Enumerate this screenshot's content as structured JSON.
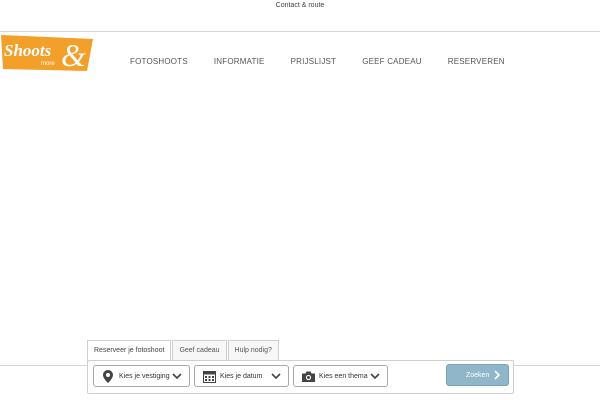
{
  "header": {
    "contact_label": "Contact & route"
  },
  "logo": {
    "word_main": "Shoots",
    "word_sub": "more",
    "ampersand": "&",
    "bg_color": "#f3a02b"
  },
  "nav": {
    "items": [
      {
        "label": "FOTOSHOOTS"
      },
      {
        "label": "INFORMATIE"
      },
      {
        "label": "PRIJSLIJST"
      },
      {
        "label": "GEEF CADEAU"
      },
      {
        "label": "RESERVEREN"
      }
    ]
  },
  "booking": {
    "tabs": [
      {
        "label": "Reserveer je fotoshoot",
        "active": true
      },
      {
        "label": "Geef cadeau",
        "active": false
      },
      {
        "label": "Hulp nodig?",
        "active": false
      }
    ],
    "selectors": [
      {
        "label": "Kies je vestiging",
        "icon": "map-pin-icon"
      },
      {
        "label": "Kies je datum",
        "icon": "calendar-icon"
      },
      {
        "label": "Kies een thema",
        "icon": "camera-icon"
      }
    ],
    "search_label": "Zoeken",
    "search_color": "#8fb7c9"
  }
}
